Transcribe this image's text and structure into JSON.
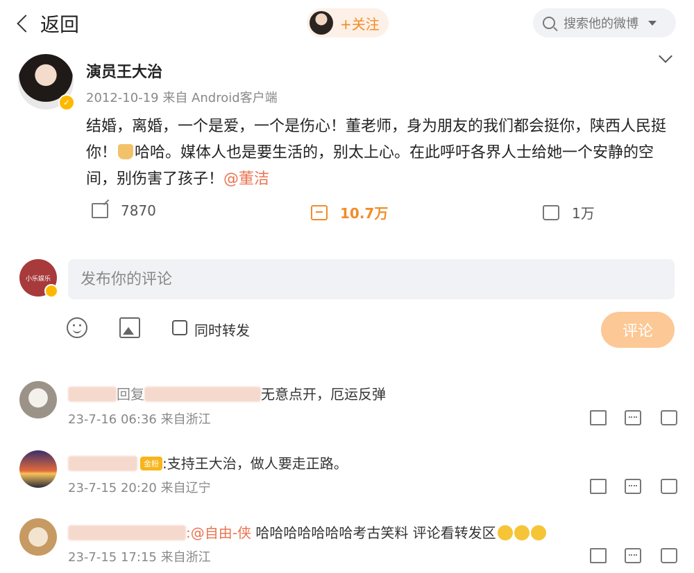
{
  "header": {
    "back_label": "返回",
    "follow_label": "+关注",
    "search_placeholder": "搜索他的微博"
  },
  "post": {
    "author": "演员王大治",
    "meta": "2012-10-19  来自 Android客户端",
    "text_before_emoji": "结婚，离婚，一个是爱，一个是伤心！董老师，身为朋友的我们都会挺你，陕西人民挺你！",
    "text_after_emoji": "哈哈。媒体人也是要生活的，别太上心。在此呼吁各界人士给她一个安静的空间，别伤害了孩子！",
    "mention": "@董洁",
    "reposts": "7870",
    "comments": "10.7万",
    "likes": "1万"
  },
  "composer": {
    "avatar_text": "小乐娱乐",
    "placeholder": "发布你的评论",
    "repost_checkbox_label": "同时转发",
    "submit_label": "评论"
  },
  "comments": [
    {
      "reply_word": "回复",
      "text": "无意点开，厄运反弹",
      "meta": "23-7-16 06:36 来自浙江"
    },
    {
      "badge": "金粉",
      "text": ":支持王大治，做人要走正路。",
      "meta": "23-7-15 20:20 来自辽宁"
    },
    {
      "mention": ":@自由-侠",
      "text": " 哈哈哈哈哈哈哈考古笑料 评论看转发区",
      "meta": "23-7-15 17:15 来自浙江"
    }
  ],
  "colors": {
    "accent": "#f28c28",
    "mention": "#eb7350",
    "button_disabled": "#fcc895",
    "input_bg": "#f1f2f5"
  }
}
